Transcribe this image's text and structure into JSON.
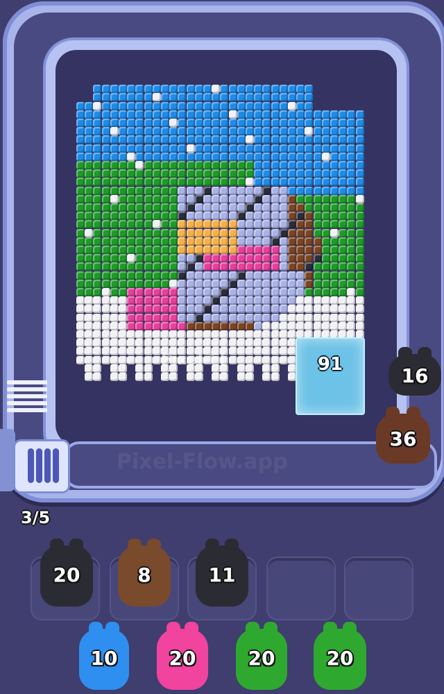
{
  "game": {
    "watermark": "Pixel-Flow.app",
    "art_watermark": "Pixel-Fl",
    "queue_counter": "3/5",
    "ice_block_count": "91",
    "belt_shooters": [
      {
        "color": "#2b2b33",
        "count": "16"
      },
      {
        "color": "#6b3a26",
        "count": "36"
      }
    ],
    "waiting_slots": [
      {
        "color": "#2b2b33",
        "count": "20",
        "filled": true
      },
      {
        "color": "#7a4a2c",
        "count": "8",
        "filled": true
      },
      {
        "color": "#2b2b33",
        "count": "11",
        "filled": true
      },
      {
        "filled": false
      },
      {
        "filled": false
      }
    ],
    "queue_shooters": [
      {
        "color": "#2f8ff0",
        "count": "10"
      },
      {
        "color": "#f0449e",
        "count": "20"
      },
      {
        "color": "#2fa82f",
        "count": "20"
      },
      {
        "color": "#2fa82f",
        "count": "20"
      }
    ],
    "palette": {
      "sky": "#1f8be8",
      "tree": "#1f9a2a",
      "snow": "#f2f2f6",
      "face": "#f5b04a",
      "pink": "#e63f9c",
      "brown": "#7a4525",
      "lavender": "#a9b2e6",
      "dark": "#2a2d3a"
    }
  }
}
